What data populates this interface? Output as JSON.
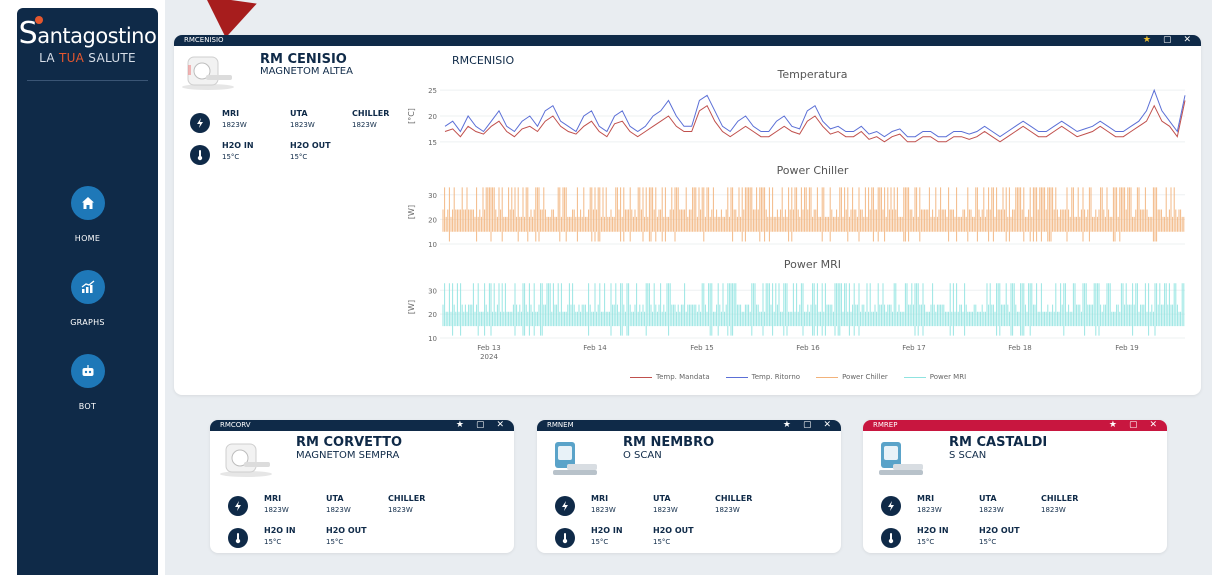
{
  "sidebar": {
    "logo_main": "antagostino",
    "logo_s": "S",
    "logo_sub_a": "LA ",
    "logo_sub_b": "TUA",
    "logo_sub_c": " SALUTE",
    "items": [
      {
        "label": "HOME",
        "icon": "home-icon"
      },
      {
        "label": "GRAPHS",
        "icon": "graph-icon"
      },
      {
        "label": "BOT",
        "icon": "bot-icon"
      }
    ]
  },
  "main_panel": {
    "header": "RMCENISIO",
    "title": "RM CENISIO",
    "model": "MAGNETOM ALTEA",
    "mri_label": "MRI",
    "mri_val": "1823W",
    "uta_label": "UTA",
    "uta_val": "1823W",
    "chiller_label": "CHILLER",
    "chiller_val": "1823W",
    "h2o_in_label": "H2O IN",
    "h2o_in_val": "15°C",
    "h2o_out_label": "H2O OUT",
    "h2o_out_val": "15°C",
    "chart_header": "RMCENISIO"
  },
  "cards": [
    {
      "header": "RMCORV",
      "title": "RM CORVETTO",
      "model": "MAGNETOM SEMPRA",
      "mri_label": "MRI",
      "mri_val": "1823W",
      "uta_label": "UTA",
      "uta_val": "1823W",
      "chiller_label": "CHILLER",
      "chiller_val": "1823W",
      "h2o_in_label": "H2O IN",
      "h2o_in_val": "15°C",
      "h2o_out_label": "H2O OUT",
      "h2o_out_val": "15°C",
      "alert": false
    },
    {
      "header": "RMNEM",
      "title": "RM NEMBRO",
      "model": "O SCAN",
      "mri_label": "MRI",
      "mri_val": "1823W",
      "uta_label": "UTA",
      "uta_val": "1823W",
      "chiller_label": "CHILLER",
      "chiller_val": "1823W",
      "h2o_in_label": "H2O IN",
      "h2o_in_val": "15°C",
      "h2o_out_label": "H2O OUT",
      "h2o_out_val": "15°C",
      "alert": false
    },
    {
      "header": "RMREP",
      "title": "RM CASTALDI",
      "model": "S SCAN",
      "mri_label": "MRI",
      "mri_val": "1823W",
      "uta_label": "UTA",
      "uta_val": "1823W",
      "chiller_label": "CHILLER",
      "chiller_val": "1823W",
      "h2o_in_label": "H2O IN",
      "h2o_in_val": "15°C",
      "h2o_out_label": "H2O OUT",
      "h2o_out_val": "15°C",
      "alert": true
    }
  ],
  "colors": {
    "navy": "#0f2a48",
    "temp_mandata": "#c0504d",
    "temp_ritorno": "#5b6fd6",
    "power_chiller": "#f2b27a",
    "power_mri": "#8fe3e0",
    "alert_red": "#c8163f",
    "star": "#f2c230"
  },
  "chart_data": [
    {
      "type": "line",
      "title": "Temperatura",
      "ylabel": "[°C]",
      "ylim": [
        14,
        26
      ],
      "yticks": [
        "25",
        "20",
        "15"
      ],
      "x_ticks": [
        "Feb 13\n2024",
        "Feb 14",
        "Feb 15",
        "Feb 16",
        "Feb 17",
        "Feb 18",
        "Feb 19"
      ],
      "series": [
        {
          "name": "Temp. Mandata",
          "color": "#c0504d",
          "values": [
            17,
            17.5,
            16,
            18,
            17,
            16.5,
            18,
            19,
            17,
            16,
            17.5,
            18,
            17,
            19,
            20,
            18,
            17,
            16.5,
            18,
            19,
            17,
            16,
            18.5,
            19,
            17,
            16,
            17,
            18,
            19,
            20,
            18,
            17,
            17,
            21,
            22,
            19,
            17,
            16,
            17,
            18,
            17,
            16,
            16,
            17,
            18,
            17,
            16.5,
            19,
            20,
            18,
            16.5,
            17,
            16,
            16,
            17,
            15.5,
            16,
            15,
            16,
            16.5,
            15,
            15,
            16,
            16,
            15,
            15,
            16,
            16,
            15.5,
            16,
            17,
            16,
            15,
            16,
            17,
            18,
            17,
            16,
            16,
            17,
            18,
            17,
            16,
            16.5,
            17,
            18,
            17,
            16,
            16,
            17,
            18,
            19,
            22,
            19,
            18,
            16,
            23
          ]
        },
        {
          "name": "Temp. Ritorno",
          "color": "#5b6fd6",
          "values": [
            18,
            19,
            17,
            20,
            18,
            17,
            19,
            21,
            18,
            17,
            19,
            20,
            18,
            21,
            22,
            19,
            18,
            17,
            20,
            21,
            18,
            17,
            20,
            21,
            18,
            17,
            18,
            20,
            21,
            23,
            20,
            18,
            18,
            23,
            24,
            21,
            18,
            17,
            19,
            20,
            18,
            17,
            17,
            19,
            20,
            18,
            17.5,
            21,
            22,
            19,
            17.5,
            18,
            17,
            17,
            18,
            16.5,
            17,
            16,
            17,
            17.5,
            16,
            16,
            17,
            17,
            16,
            16,
            17,
            17,
            16.5,
            17,
            18,
            17,
            16,
            17,
            18,
            19,
            18,
            17,
            17,
            18,
            19,
            18,
            17,
            17.5,
            18,
            19,
            18,
            17,
            17,
            18,
            19,
            21,
            25,
            21,
            19,
            17,
            24
          ]
        }
      ]
    },
    {
      "type": "line",
      "title": "Power Chiller",
      "ylabel": "[W]",
      "ylim": [
        10,
        36
      ],
      "yticks": [
        "30",
        "20",
        "10"
      ],
      "series": [
        {
          "name": "Power Chiller",
          "color": "#f2b27a"
        }
      ]
    },
    {
      "type": "line",
      "title": "Power MRI",
      "ylabel": "[W]",
      "ylim": [
        10,
        36
      ],
      "yticks": [
        "30",
        "20",
        "10"
      ],
      "series": [
        {
          "name": "Power MRI",
          "color": "#8fe3e0"
        }
      ]
    }
  ],
  "legend": [
    "Temp. Mandata",
    "Temp. Ritorno",
    "Power Chiller",
    "Power MRI"
  ]
}
